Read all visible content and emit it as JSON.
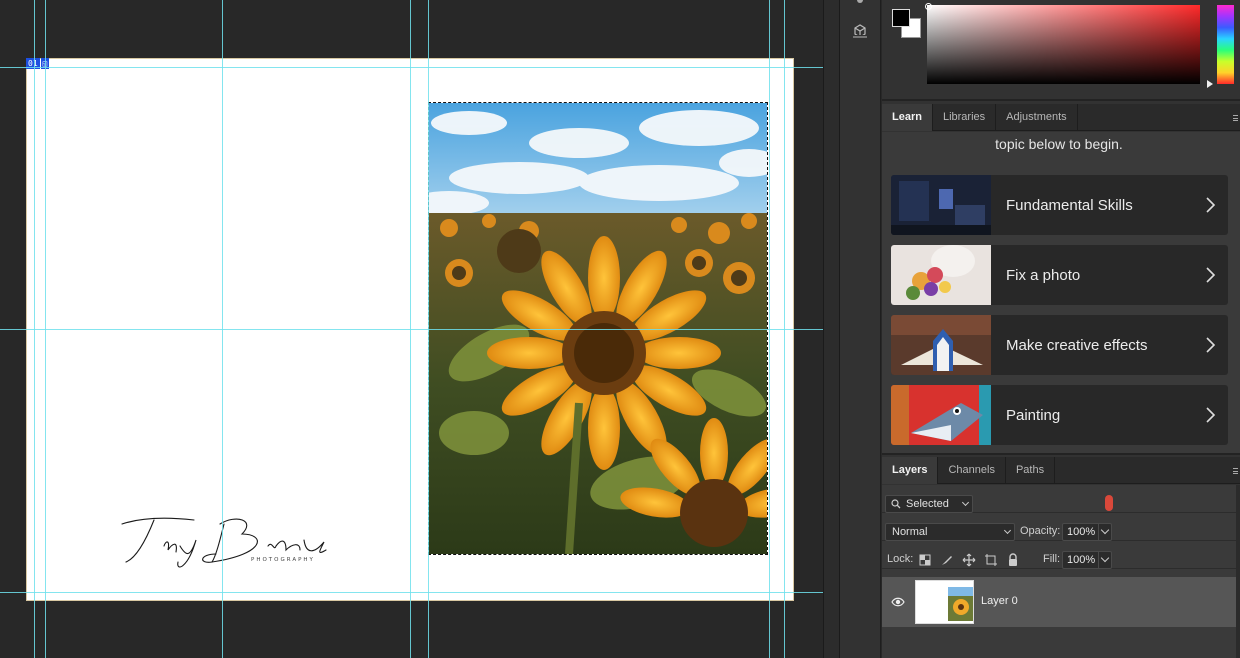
{
  "document": {
    "artboard_badge": [
      "01",
      "◱"
    ],
    "logo_text": "Tiny Birch",
    "logo_subtext": "PHOTOGRAPHY"
  },
  "panels": {
    "color": {
      "foreground": "#000000",
      "background": "#ffffff"
    },
    "learn_tabs": [
      "Learn",
      "Libraries",
      "Adjustments"
    ],
    "learn": {
      "intro_partial_top": "                          ",
      "intro": "topic below to begin.",
      "cards": [
        {
          "title": "Fundamental Skills",
          "thumb": "dark-room-thumbnail"
        },
        {
          "title": "Fix a photo",
          "thumb": "flowers-thumbnail"
        },
        {
          "title": "Make creative effects",
          "thumb": "creative-thumbnail"
        },
        {
          "title": "Painting",
          "thumb": "fish-thumbnail"
        }
      ]
    },
    "layers_tabs": [
      "Layers",
      "Channels",
      "Paths"
    ],
    "layers": {
      "filter_value": "Selected",
      "blend_mode": "Normal",
      "opacity_label": "Opacity:",
      "opacity_value": "100%",
      "lock_label": "Lock:",
      "fill_label": "Fill:",
      "fill_value": "100%",
      "items": [
        {
          "name": "Layer 0",
          "visible": true
        }
      ]
    }
  }
}
